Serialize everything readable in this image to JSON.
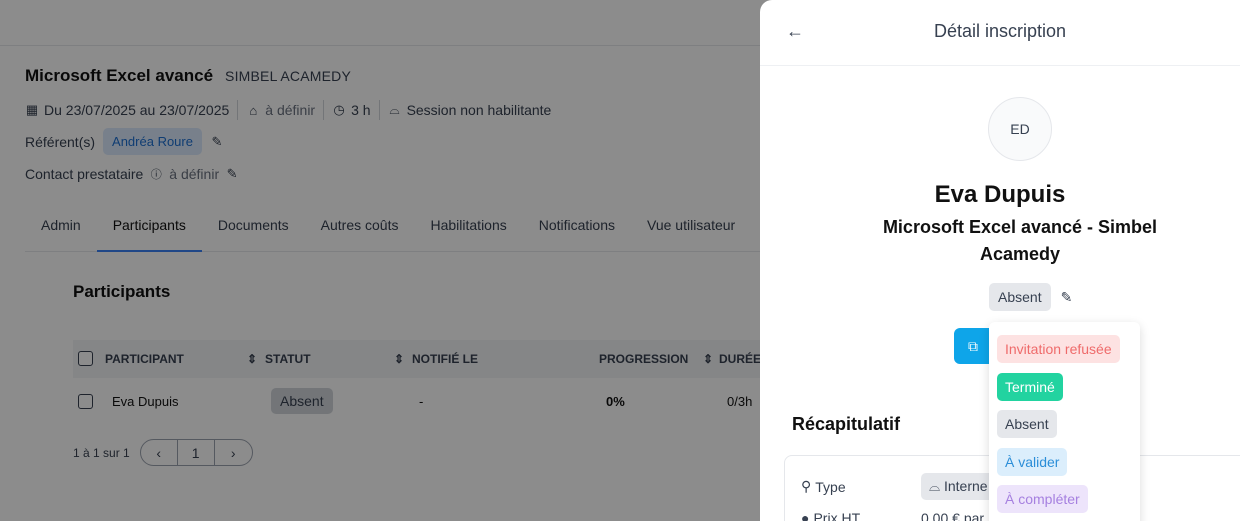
{
  "session": {
    "title": "Microsoft Excel avancé",
    "provider": "SIMBEL ACAMEDY",
    "dates": "Du 23/07/2025 au 23/07/2025",
    "price": "à définir",
    "duration": "3 h",
    "habilitation": "Session non habilitante",
    "referents_label": "Référent(s)",
    "referent": "Andréa Roure",
    "contact_label": "Contact prestataire",
    "contact_value": "à définir"
  },
  "tabs": [
    "Admin",
    "Participants",
    "Documents",
    "Autres coûts",
    "Habilitations",
    "Notifications",
    "Vue utilisateur"
  ],
  "participants": {
    "title": "Participants",
    "columns": [
      "PARTICIPANT",
      "STATUT",
      "NOTIFIÉ LE",
      "PROGRESSION",
      "DURÉE"
    ],
    "rows": [
      {
        "name": "Eva Dupuis",
        "status": "Absent",
        "notified": "-",
        "progress": "0%",
        "duration": "0/3h"
      }
    ],
    "pagination_text": "1 à 1 sur 1",
    "page": "1"
  },
  "drawer": {
    "title": "Détail inscription",
    "avatar_initials": "ED",
    "person_name": "Eva Dupuis",
    "course_name": "Microsoft Excel avancé - Simbel Acamedy",
    "status": "Absent",
    "recap_title": "Récapitulatif",
    "recap": {
      "type_label": "Type",
      "type_value": "Interne",
      "price_label": "Prix HT",
      "price_value": "0,00 € par"
    }
  },
  "status_options": [
    {
      "label": "Invitation refusée",
      "bg": "#fde2e2",
      "fg": "#ef6b6b"
    },
    {
      "label": "Terminé",
      "bg": "#22d3a0",
      "fg": "#ffffff"
    },
    {
      "label": "Absent",
      "bg": "#e5e7eb",
      "fg": "#374151"
    },
    {
      "label": "À valider",
      "bg": "#dbeefc",
      "fg": "#2b8ed8"
    },
    {
      "label": "À compléter",
      "bg": "#ede4fb",
      "fg": "#a680e0"
    }
  ],
  "colors": {
    "accent": "#3b82f6",
    "open_button": "#0ea5e9"
  }
}
